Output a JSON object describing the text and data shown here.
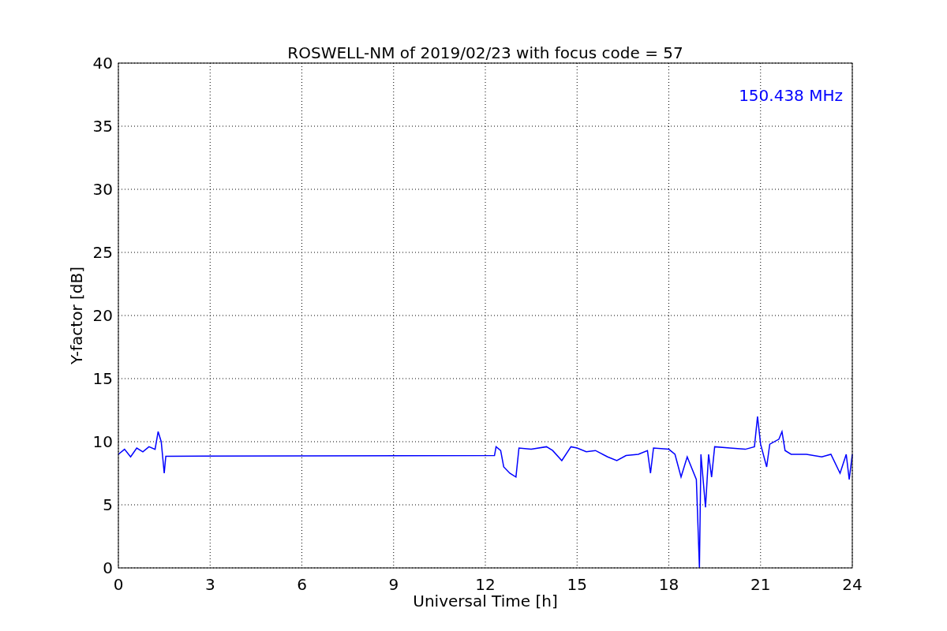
{
  "chart": {
    "chart_data": {
      "type": "line",
      "title": "ROSWELL-NM of 2019/02/23 with focus code = 57",
      "xlabel": "Universal Time [h]",
      "ylabel": "Y-factor [dB]",
      "xlim": [
        0,
        24
      ],
      "ylim": [
        0,
        40
      ],
      "xticks": [
        0,
        3,
        6,
        9,
        12,
        15,
        18,
        21,
        24
      ],
      "yticks": [
        0,
        5,
        10,
        15,
        20,
        25,
        30,
        35,
        40
      ],
      "x": [
        0,
        0.2,
        0.4,
        0.6,
        0.8,
        1.0,
        1.2,
        1.3,
        1.4,
        1.5,
        1.55,
        12.3,
        12.35,
        12.5,
        12.6,
        12.8,
        13.0,
        13.1,
        13.5,
        14.0,
        14.2,
        14.5,
        14.8,
        15.0,
        15.3,
        15.6,
        16.0,
        16.3,
        16.6,
        17.0,
        17.3,
        17.4,
        17.5,
        18.0,
        18.2,
        18.4,
        18.6,
        18.9,
        19.0,
        19.05,
        19.2,
        19.3,
        19.4,
        19.5,
        20.0,
        20.5,
        20.8,
        20.9,
        21.0,
        21.2,
        21.3,
        21.6,
        21.7,
        21.8,
        22.0,
        22.5,
        23.0,
        23.3,
        23.6,
        23.8,
        23.9,
        24.0
      ],
      "series": [
        {
          "name": "150.438 MHz",
          "color": "#0000ff",
          "values": [
            9.0,
            9.4,
            8.8,
            9.5,
            9.2,
            9.6,
            9.4,
            10.8,
            10.0,
            7.5,
            8.85,
            8.9,
            9.6,
            9.3,
            8.0,
            7.5,
            7.2,
            9.5,
            9.4,
            9.6,
            9.3,
            8.5,
            9.6,
            9.5,
            9.2,
            9.3,
            8.8,
            8.5,
            8.9,
            9.0,
            9.3,
            7.5,
            9.5,
            9.4,
            9.0,
            7.2,
            8.8,
            7.0,
            0,
            9.0,
            4.8,
            9.0,
            7.2,
            9.6,
            9.5,
            9.4,
            9.6,
            12.0,
            9.8,
            8.0,
            9.8,
            10.2,
            10.8,
            9.3,
            9.0,
            9.0,
            8.8,
            9.0,
            7.5,
            9.0,
            7.0,
            9.0
          ]
        }
      ],
      "grid": true
    }
  }
}
